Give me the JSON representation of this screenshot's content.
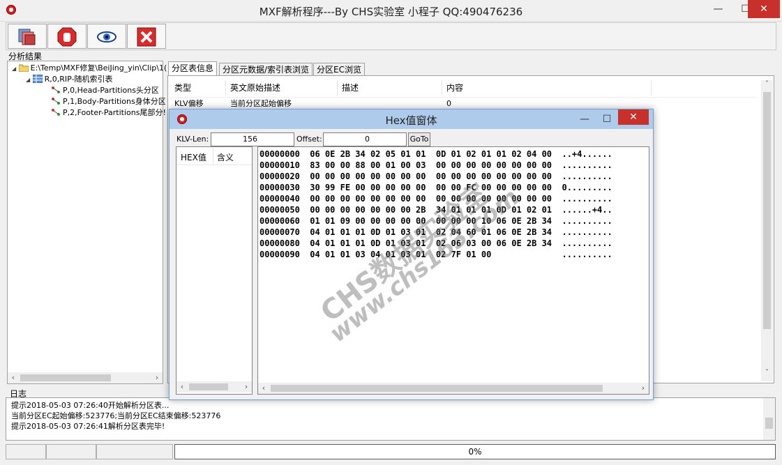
{
  "window": {
    "title": "MXF解析程序---By CHS实验室 小程子 QQ:490476236",
    "min_glyph": "—",
    "max_glyph": "☐",
    "close_glyph": "✕"
  },
  "toolbar": {
    "buttons": [
      "open-files-icon",
      "stop-icon",
      "view-eye-icon",
      "close-red-x-icon"
    ]
  },
  "analysis": {
    "label": "分析结果",
    "tree": {
      "root": "E:\\Temp\\MXF修复\\BeiJing_yin\\Clip\\1(",
      "rip": "R,0,RIP-随机索引表",
      "partitions": [
        "P,0,Head-Partitions头分区",
        "P,1,Body-Partitions身体分区",
        "P,2,Footer-Partitions尾部分!"
      ]
    }
  },
  "tabs": [
    "分区表信息",
    "分区元数据/索引表浏览",
    "分区EC浏览"
  ],
  "grid": {
    "headers": [
      "类型",
      "英文原始描述",
      "描述",
      "内容"
    ],
    "rows": [
      [
        "KLV偏移",
        "当前分区起始偏移",
        "",
        "0"
      ]
    ]
  },
  "log": {
    "label": "日志",
    "lines": [
      "提示2018-05-03 07:26:40开始解析分区表...",
      "当前分区EC起始偏移:523776;当前分区EC结束偏移:523776",
      "提示2018-05-03 07:26:41解析分区表完毕!"
    ]
  },
  "status": {
    "progress_text": "0%",
    "progress": 0
  },
  "hex_dialog": {
    "title": "Hex值窗体",
    "klv_len_label": "KLV-Len:",
    "klv_len_value": "156",
    "offset_label": "Offset:",
    "offset_value": "0",
    "goto_label": "GoTo",
    "left_headers": [
      "HEX值",
      "含义"
    ],
    "lines": [
      "00000000  06 0E 2B 34 02 05 01 01  0D 01 02 01 01 02 04 00  ..+4......",
      "00000010  83 00 00 88 00 01 00 03  00 00 00 00 00 00 00 00  ..........",
      "00000020  00 00 00 00 00 00 00 00  00 00 00 00 00 00 00 00  ..........",
      "00000030  30 99 FE 00 00 00 00 00  00 00 FC 00 00 00 00 00  0.........",
      "00000040  00 00 00 00 00 00 00 00  00 00 00 00 00 00 00 00  ..........",
      "00000050  00 00 00 00 00 00 00 2B  34 01 01 01 0D 01 02 01  ......+4..",
      "00000060  01 01 09 00 00 00 00 00  00 00 00 10 06 0E 2B 34  ..........",
      "00000070  04 01 01 01 0D 01 03 01  02 04 60 01 06 0E 2B 34  ..........",
      "00000080  04 01 01 01 0D 01 03 01  02 06 03 00 06 0E 2B 34  ..........",
      "00000090  04 01 01 03 04 01 03 01  02 7F 01 00              .........."
    ],
    "watermark1": "CHS数据实验室",
    "watermark2": "www.chs163.com"
  }
}
